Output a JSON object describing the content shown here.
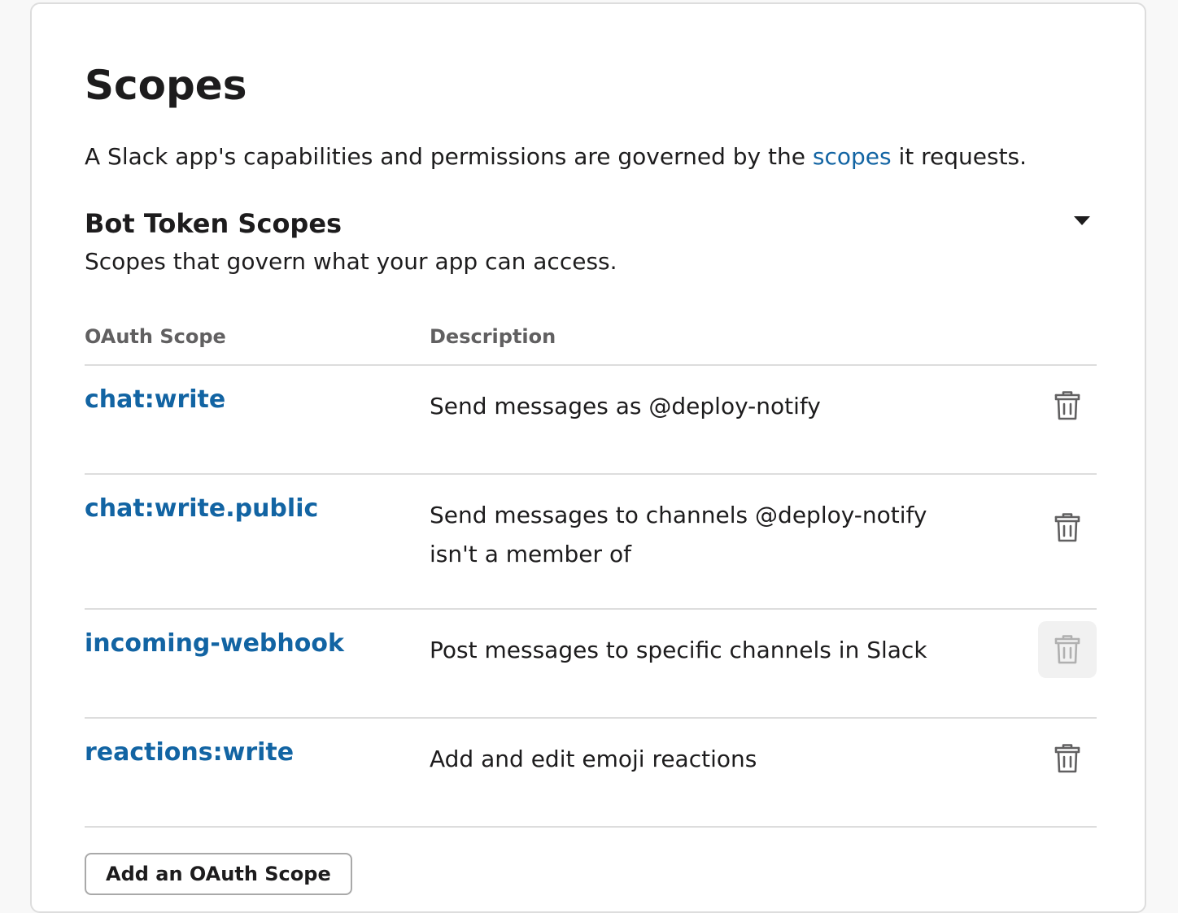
{
  "page": {
    "title": "Scopes",
    "intro_before": "A Slack app's capabilities and permissions are governed by the ",
    "intro_link": "scopes",
    "intro_after": " it requests."
  },
  "section": {
    "title": "Bot Token Scopes",
    "subtitle": "Scopes that govern what your app can access.",
    "toggle_icon": "caret-down-icon"
  },
  "table": {
    "columns": [
      "OAuth Scope",
      "Description"
    ],
    "rows": [
      {
        "scope": "chat:write",
        "description": "Send messages as @deploy-notify",
        "delete_icon": "trash-icon"
      },
      {
        "scope": "chat:write.public",
        "description": "Send messages to channels @deploy-notify isn't a member of",
        "delete_icon": "trash-icon"
      },
      {
        "scope": "incoming-webhook",
        "description": "Post messages to specific channels in Slack",
        "delete_icon": "trash-icon",
        "state": "hover"
      },
      {
        "scope": "reactions:write",
        "description": "Add and edit emoji reactions",
        "delete_icon": "trash-icon"
      }
    ]
  },
  "actions": {
    "add_scope_label": "Add an OAuth Scope"
  },
  "colors": {
    "link": "#1264a3",
    "text": "#1d1c1d",
    "muted": "#616061",
    "divider": "#dddddd",
    "icon": "#616061",
    "icon_disabled": "#b0b0b0"
  }
}
